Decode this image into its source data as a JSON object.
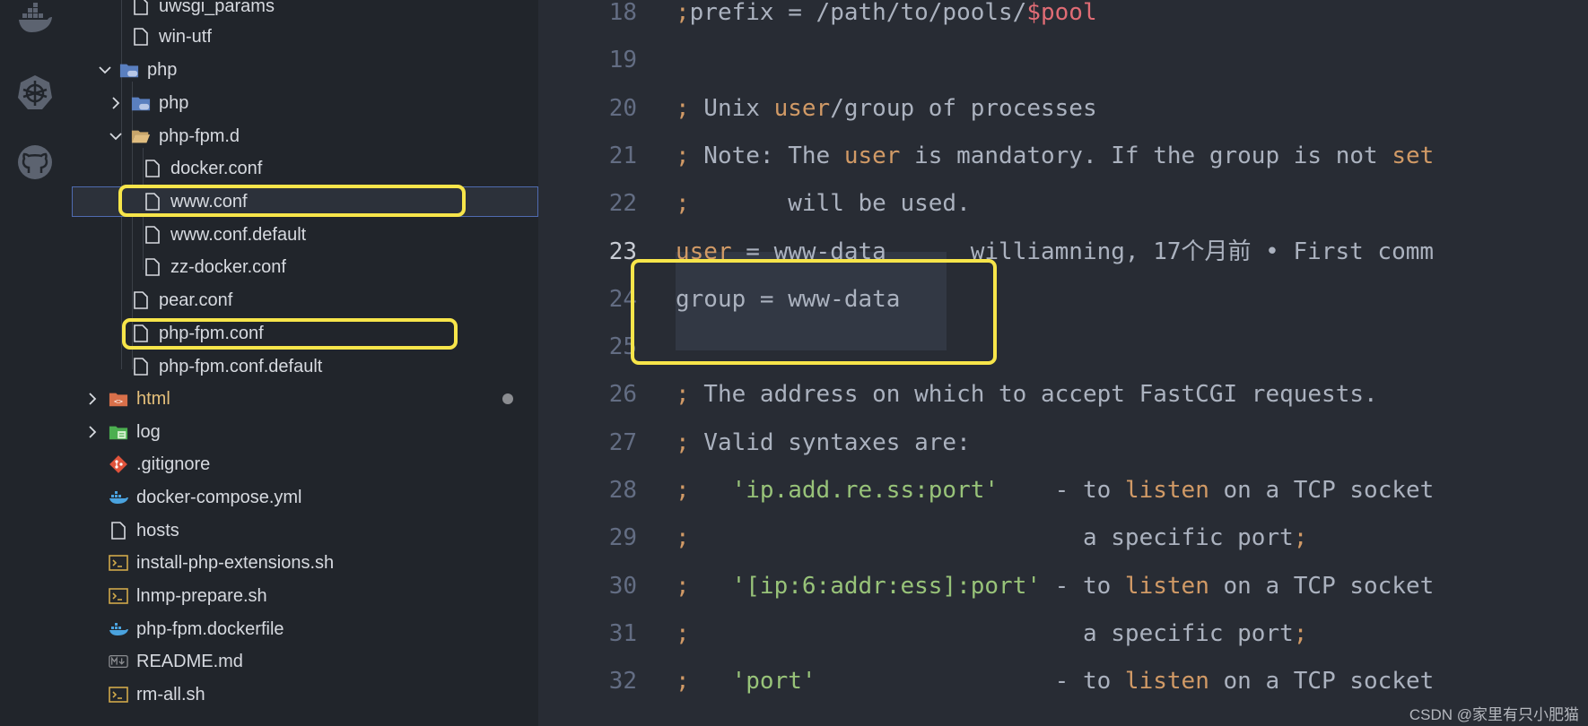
{
  "activity_bar": {
    "icons": [
      "docker-icon",
      "kubernetes-icon",
      "github-icon"
    ]
  },
  "explorer": {
    "items": [
      {
        "label": "uwsgi_params",
        "icon": "file-icon"
      },
      {
        "label": "win-utf",
        "icon": "file-icon"
      },
      {
        "label": "php",
        "icon": "php-folder-icon",
        "expanded": true
      },
      {
        "label": "php",
        "icon": "php-folder-icon",
        "expanded": false
      },
      {
        "label": "php-fpm.d",
        "icon": "folder-open-icon",
        "expanded": true
      },
      {
        "label": "docker.conf",
        "icon": "file-icon"
      },
      {
        "label": "www.conf",
        "icon": "file-icon",
        "selected": true,
        "highlighted": true
      },
      {
        "label": "www.conf.default",
        "icon": "file-icon"
      },
      {
        "label": "zz-docker.conf",
        "icon": "file-icon"
      },
      {
        "label": "pear.conf",
        "icon": "file-icon"
      },
      {
        "label": "php-fpm.conf",
        "icon": "file-icon",
        "highlighted": true
      },
      {
        "label": "php-fpm.conf.default",
        "icon": "file-icon"
      },
      {
        "label": "html",
        "icon": "html-folder-icon",
        "expanded": false,
        "modified": true
      },
      {
        "label": "log",
        "icon": "log-folder-icon",
        "expanded": false
      },
      {
        "label": ".gitignore",
        "icon": "git-icon"
      },
      {
        "label": "docker-compose.yml",
        "icon": "docker-icon"
      },
      {
        "label": "hosts",
        "icon": "file-icon"
      },
      {
        "label": "install-php-extensions.sh",
        "icon": "terminal-icon"
      },
      {
        "label": "lnmp-prepare.sh",
        "icon": "terminal-icon"
      },
      {
        "label": "php-fpm.dockerfile",
        "icon": "docker-icon"
      },
      {
        "label": "README.md",
        "icon": "markdown-icon"
      },
      {
        "label": "rm-all.sh",
        "icon": "terminal-icon"
      }
    ]
  },
  "editor": {
    "active_line": "23",
    "lines": [
      {
        "num": "18",
        "segments": [
          {
            "t": ";",
            "c": "semi"
          },
          {
            "t": "prefix = /path/to/pools/",
            "c": "com"
          },
          {
            "t": "$pool",
            "c": "var"
          }
        ]
      },
      {
        "num": "19",
        "segments": []
      },
      {
        "num": "20",
        "segments": [
          {
            "t": ";",
            "c": "semi"
          },
          {
            "t": " Unix ",
            "c": "com"
          },
          {
            "t": "user",
            "c": "kw"
          },
          {
            "t": "/group of processes",
            "c": "com"
          }
        ]
      },
      {
        "num": "21",
        "segments": [
          {
            "t": ";",
            "c": "semi"
          },
          {
            "t": " Note: The ",
            "c": "com"
          },
          {
            "t": "user",
            "c": "kw"
          },
          {
            "t": " is mandatory. If the group is not ",
            "c": "com"
          },
          {
            "t": "set",
            "c": "kw"
          }
        ]
      },
      {
        "num": "22",
        "segments": [
          {
            "t": ";",
            "c": "semi"
          },
          {
            "t": "       will be used.",
            "c": "com"
          }
        ]
      },
      {
        "num": "23",
        "segments": [
          {
            "t": "user",
            "c": "kw"
          },
          {
            "t": " = www-data",
            "c": "com"
          },
          {
            "t": "      williamning, 17个月前 • First comm",
            "c": "blame"
          }
        ]
      },
      {
        "num": "24",
        "segments": [
          {
            "t": "group = www-data",
            "c": "com"
          }
        ]
      },
      {
        "num": "25",
        "segments": []
      },
      {
        "num": "26",
        "segments": [
          {
            "t": ";",
            "c": "semi"
          },
          {
            "t": " The address on which to accept FastCGI requests.",
            "c": "com"
          }
        ]
      },
      {
        "num": "27",
        "segments": [
          {
            "t": ";",
            "c": "semi"
          },
          {
            "t": " Valid syntaxes are:",
            "c": "com"
          }
        ]
      },
      {
        "num": "28",
        "segments": [
          {
            "t": ";",
            "c": "semi"
          },
          {
            "t": "   ",
            "c": "com"
          },
          {
            "t": "'ip.add.re.ss:port'",
            "c": "str"
          },
          {
            "t": "    - to ",
            "c": "com"
          },
          {
            "t": "listen",
            "c": "kw"
          },
          {
            "t": " on a TCP socket",
            "c": "com"
          }
        ]
      },
      {
        "num": "29",
        "segments": [
          {
            "t": ";",
            "c": "semi"
          },
          {
            "t": "                            a specific port",
            "c": "com"
          },
          {
            "t": ";",
            "c": "semi"
          }
        ]
      },
      {
        "num": "30",
        "segments": [
          {
            "t": ";",
            "c": "semi"
          },
          {
            "t": "   ",
            "c": "com"
          },
          {
            "t": "'[ip:6:addr:ess]:port'",
            "c": "str"
          },
          {
            "t": " - to ",
            "c": "com"
          },
          {
            "t": "listen",
            "c": "kw"
          },
          {
            "t": " on a TCP socket",
            "c": "com"
          }
        ]
      },
      {
        "num": "31",
        "segments": [
          {
            "t": ";",
            "c": "semi"
          },
          {
            "t": "                            a specific port",
            "c": "com"
          },
          {
            "t": ";",
            "c": "semi"
          }
        ]
      },
      {
        "num": "32",
        "segments": [
          {
            "t": ";",
            "c": "semi"
          },
          {
            "t": "   ",
            "c": "com"
          },
          {
            "t": "'port'",
            "c": "str"
          },
          {
            "t": "                 - to ",
            "c": "com"
          },
          {
            "t": "listen",
            "c": "kw"
          },
          {
            "t": " on a TCP socket",
            "c": "com"
          }
        ]
      }
    ]
  },
  "watermark": "CSDN @家里有只小肥猫",
  "colors": {
    "highlight_box": "#f7e54a",
    "background": "#282c34",
    "sidebar": "#21252b"
  }
}
